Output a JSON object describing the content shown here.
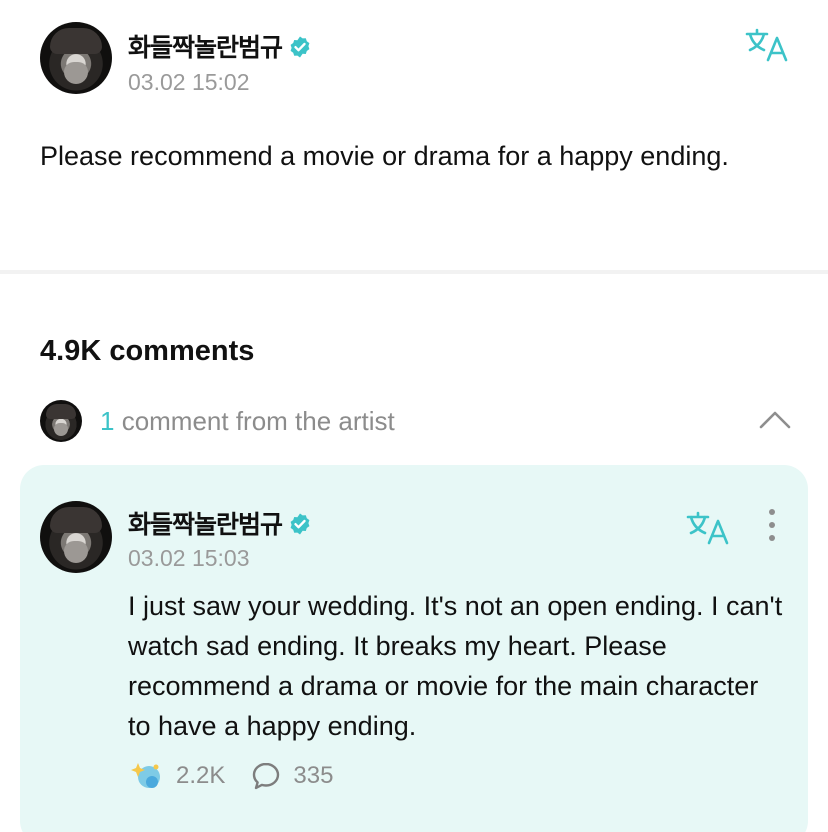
{
  "post": {
    "author": "화들짝놀란범규",
    "timestamp": "03.02 15:02",
    "text": "Please recommend a movie or drama for a happy ending."
  },
  "comments_section": {
    "count_label": "4.9K comments",
    "artist_count": "1",
    "artist_label": " comment from the artist"
  },
  "artist_comment": {
    "author": "화들짝놀란범규",
    "timestamp": "03.02 15:03",
    "text": "I just saw your wedding. It's not an open ending. I can't watch sad ending. It breaks my heart. Please recommend a drama or movie for the main character to have a happy ending.",
    "likes": "2.2K",
    "replies": "335"
  },
  "icons": {
    "verified": "verified-badge-icon",
    "translate": "translate-icon",
    "chevron": "chevron-up-icon",
    "more": "more-vertical-icon",
    "reaction": "sparkle-reaction-icon",
    "reply": "speech-bubble-icon"
  },
  "colors": {
    "accent": "#3cc3c8",
    "card_background": "#e7f8f6",
    "muted_text": "#9a9a9a"
  }
}
